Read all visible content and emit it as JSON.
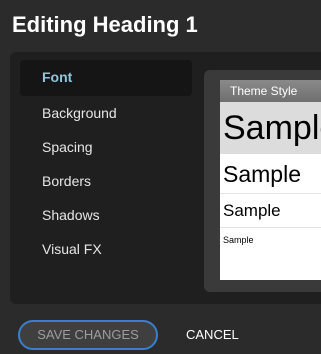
{
  "dialog": {
    "title": "Editing Heading 1"
  },
  "sidebar": {
    "items": [
      {
        "label": "Font",
        "active": true
      },
      {
        "label": "Background",
        "active": false
      },
      {
        "label": "Spacing",
        "active": false
      },
      {
        "label": "Borders",
        "active": false
      },
      {
        "label": "Shadows",
        "active": false
      },
      {
        "label": "Visual FX",
        "active": false
      }
    ]
  },
  "preview": {
    "header": "Theme Style",
    "samples": [
      "Sample",
      "Sample",
      "Sample",
      "Sample"
    ]
  },
  "footer": {
    "save_label": "SAVE CHANGES",
    "cancel_label": "CANCEL"
  },
  "colors": {
    "background": "#2b2b2b",
    "panel": "#1f1f1f",
    "active_item_text": "#8ec7dd",
    "focus_ring": "#3a7fcf"
  }
}
